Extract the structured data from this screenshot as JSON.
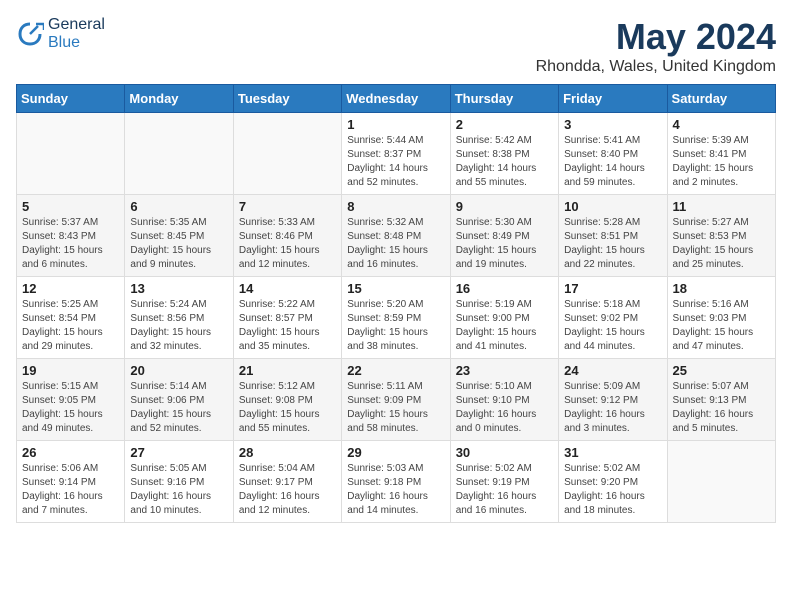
{
  "header": {
    "logo_general": "General",
    "logo_blue": "Blue",
    "month_title": "May 2024",
    "location": "Rhondda, Wales, United Kingdom"
  },
  "days_of_week": [
    "Sunday",
    "Monday",
    "Tuesday",
    "Wednesday",
    "Thursday",
    "Friday",
    "Saturday"
  ],
  "weeks": [
    [
      {
        "day": "",
        "info": ""
      },
      {
        "day": "",
        "info": ""
      },
      {
        "day": "",
        "info": ""
      },
      {
        "day": "1",
        "info": "Sunrise: 5:44 AM\nSunset: 8:37 PM\nDaylight: 14 hours and 52 minutes."
      },
      {
        "day": "2",
        "info": "Sunrise: 5:42 AM\nSunset: 8:38 PM\nDaylight: 14 hours and 55 minutes."
      },
      {
        "day": "3",
        "info": "Sunrise: 5:41 AM\nSunset: 8:40 PM\nDaylight: 14 hours and 59 minutes."
      },
      {
        "day": "4",
        "info": "Sunrise: 5:39 AM\nSunset: 8:41 PM\nDaylight: 15 hours and 2 minutes."
      }
    ],
    [
      {
        "day": "5",
        "info": "Sunrise: 5:37 AM\nSunset: 8:43 PM\nDaylight: 15 hours and 6 minutes."
      },
      {
        "day": "6",
        "info": "Sunrise: 5:35 AM\nSunset: 8:45 PM\nDaylight: 15 hours and 9 minutes."
      },
      {
        "day": "7",
        "info": "Sunrise: 5:33 AM\nSunset: 8:46 PM\nDaylight: 15 hours and 12 minutes."
      },
      {
        "day": "8",
        "info": "Sunrise: 5:32 AM\nSunset: 8:48 PM\nDaylight: 15 hours and 16 minutes."
      },
      {
        "day": "9",
        "info": "Sunrise: 5:30 AM\nSunset: 8:49 PM\nDaylight: 15 hours and 19 minutes."
      },
      {
        "day": "10",
        "info": "Sunrise: 5:28 AM\nSunset: 8:51 PM\nDaylight: 15 hours and 22 minutes."
      },
      {
        "day": "11",
        "info": "Sunrise: 5:27 AM\nSunset: 8:53 PM\nDaylight: 15 hours and 25 minutes."
      }
    ],
    [
      {
        "day": "12",
        "info": "Sunrise: 5:25 AM\nSunset: 8:54 PM\nDaylight: 15 hours and 29 minutes."
      },
      {
        "day": "13",
        "info": "Sunrise: 5:24 AM\nSunset: 8:56 PM\nDaylight: 15 hours and 32 minutes."
      },
      {
        "day": "14",
        "info": "Sunrise: 5:22 AM\nSunset: 8:57 PM\nDaylight: 15 hours and 35 minutes."
      },
      {
        "day": "15",
        "info": "Sunrise: 5:20 AM\nSunset: 8:59 PM\nDaylight: 15 hours and 38 minutes."
      },
      {
        "day": "16",
        "info": "Sunrise: 5:19 AM\nSunset: 9:00 PM\nDaylight: 15 hours and 41 minutes."
      },
      {
        "day": "17",
        "info": "Sunrise: 5:18 AM\nSunset: 9:02 PM\nDaylight: 15 hours and 44 minutes."
      },
      {
        "day": "18",
        "info": "Sunrise: 5:16 AM\nSunset: 9:03 PM\nDaylight: 15 hours and 47 minutes."
      }
    ],
    [
      {
        "day": "19",
        "info": "Sunrise: 5:15 AM\nSunset: 9:05 PM\nDaylight: 15 hours and 49 minutes."
      },
      {
        "day": "20",
        "info": "Sunrise: 5:14 AM\nSunset: 9:06 PM\nDaylight: 15 hours and 52 minutes."
      },
      {
        "day": "21",
        "info": "Sunrise: 5:12 AM\nSunset: 9:08 PM\nDaylight: 15 hours and 55 minutes."
      },
      {
        "day": "22",
        "info": "Sunrise: 5:11 AM\nSunset: 9:09 PM\nDaylight: 15 hours and 58 minutes."
      },
      {
        "day": "23",
        "info": "Sunrise: 5:10 AM\nSunset: 9:10 PM\nDaylight: 16 hours and 0 minutes."
      },
      {
        "day": "24",
        "info": "Sunrise: 5:09 AM\nSunset: 9:12 PM\nDaylight: 16 hours and 3 minutes."
      },
      {
        "day": "25",
        "info": "Sunrise: 5:07 AM\nSunset: 9:13 PM\nDaylight: 16 hours and 5 minutes."
      }
    ],
    [
      {
        "day": "26",
        "info": "Sunrise: 5:06 AM\nSunset: 9:14 PM\nDaylight: 16 hours and 7 minutes."
      },
      {
        "day": "27",
        "info": "Sunrise: 5:05 AM\nSunset: 9:16 PM\nDaylight: 16 hours and 10 minutes."
      },
      {
        "day": "28",
        "info": "Sunrise: 5:04 AM\nSunset: 9:17 PM\nDaylight: 16 hours and 12 minutes."
      },
      {
        "day": "29",
        "info": "Sunrise: 5:03 AM\nSunset: 9:18 PM\nDaylight: 16 hours and 14 minutes."
      },
      {
        "day": "30",
        "info": "Sunrise: 5:02 AM\nSunset: 9:19 PM\nDaylight: 16 hours and 16 minutes."
      },
      {
        "day": "31",
        "info": "Sunrise: 5:02 AM\nSunset: 9:20 PM\nDaylight: 16 hours and 18 minutes."
      },
      {
        "day": "",
        "info": ""
      }
    ]
  ]
}
